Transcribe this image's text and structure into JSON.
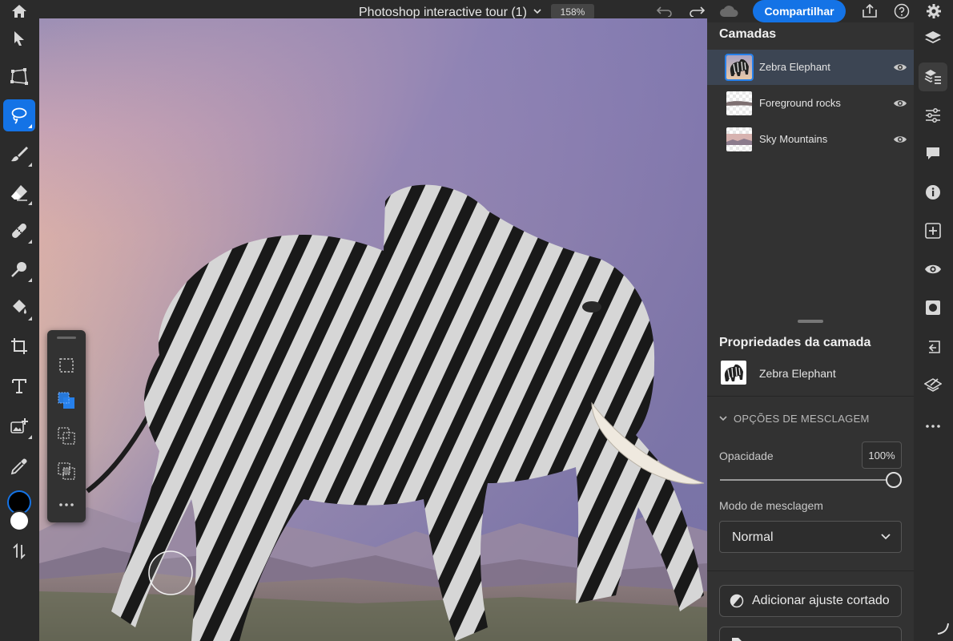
{
  "top_bar": {
    "document_title": "Photoshop interactive tour (1)",
    "zoom_level": "158%",
    "share_label": "Compartilhar"
  },
  "left_toolbar": {
    "tools": [
      "move-tool",
      "transform-tool",
      "lasso-tool",
      "brush-tool",
      "eraser-tool",
      "healing-tool",
      "dodge-tool",
      "fill-tool",
      "crop-tool",
      "type-tool",
      "place-image-tool",
      "eyedropper-tool"
    ],
    "active_tool": "lasso-tool",
    "foreground_color": "#000000",
    "background_color": "#ffffff"
  },
  "floating_toolbar": {
    "buttons": [
      "new-selection",
      "add-to-selection",
      "subtract-from-selection",
      "intersect-selection",
      "more"
    ],
    "active": "add-to-selection"
  },
  "layers_panel": {
    "title": "Camadas",
    "layers": [
      {
        "name": "Zebra Elephant",
        "visible": true,
        "selected": true
      },
      {
        "name": "Foreground rocks",
        "visible": true,
        "selected": false
      },
      {
        "name": "Sky Mountains",
        "visible": true,
        "selected": false
      }
    ]
  },
  "layer_properties": {
    "title": "Propriedades da camada",
    "layer_name": "Zebra Elephant",
    "blend_options_label": "OPÇÕES DE MESCLAGEM",
    "opacity_label": "Opacidade",
    "opacity_value": "100%",
    "opacity_fraction": 1.0,
    "blend_mode_label": "Modo de mesclagem",
    "blend_mode_value": "Normal",
    "clip_adjust_label": "Adicionar ajuste cortado"
  },
  "colors": {
    "accent": "#1473e6",
    "panel_bg": "#323232",
    "toolbar_bg": "#2b2b2b"
  }
}
